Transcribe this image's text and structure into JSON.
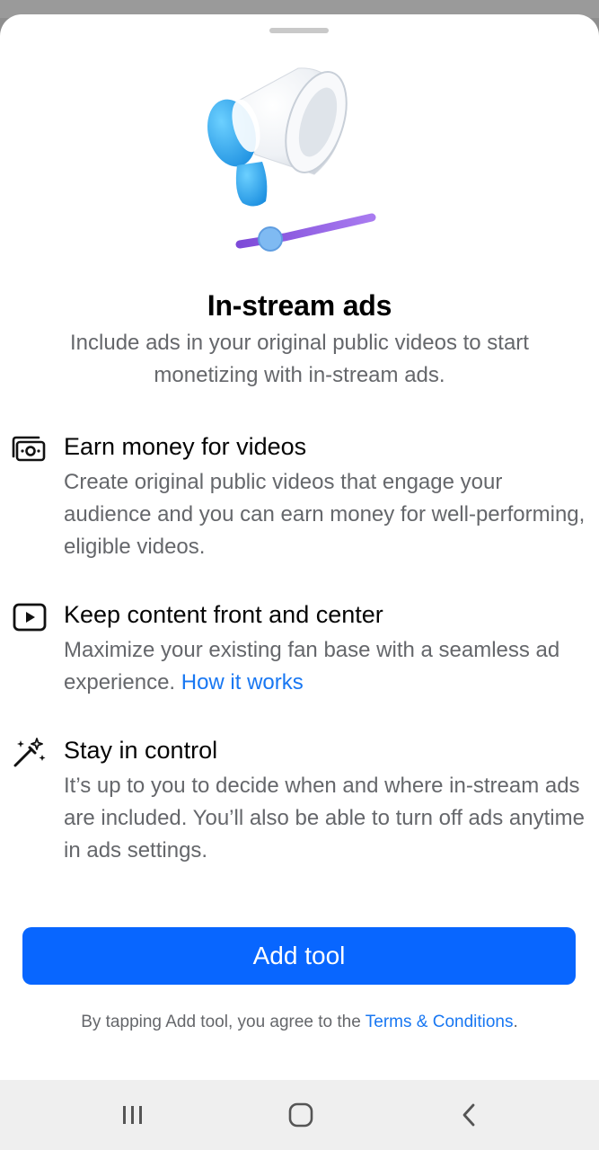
{
  "sheet": {
    "title": "In-stream ads",
    "subtitle": "Include ads in your original public videos to start monetizing with in-stream ads."
  },
  "features": [
    {
      "icon": "money-icon",
      "title": "Earn money for videos",
      "description": "Create original public videos that engage your audience and you can earn money for well-performing, eligible videos."
    },
    {
      "icon": "play-icon",
      "title": "Keep content front and center",
      "description": "Maximize your existing fan base with a seamless ad experience.",
      "link": "How it works"
    },
    {
      "icon": "magic-wand-icon",
      "title": "Stay in control",
      "description": "It’s up to you to decide when and where in-stream ads are included. You’ll also be able to turn off ads anytime in ads settings."
    }
  ],
  "cta": {
    "label": "Add tool"
  },
  "legal": {
    "text": "By tapping Add tool, you agree to the",
    "link": "Terms & Conditions",
    "end": "."
  },
  "colors": {
    "primary": "#0866ff",
    "link": "#1877f2",
    "secondary_text": "#65676b"
  }
}
